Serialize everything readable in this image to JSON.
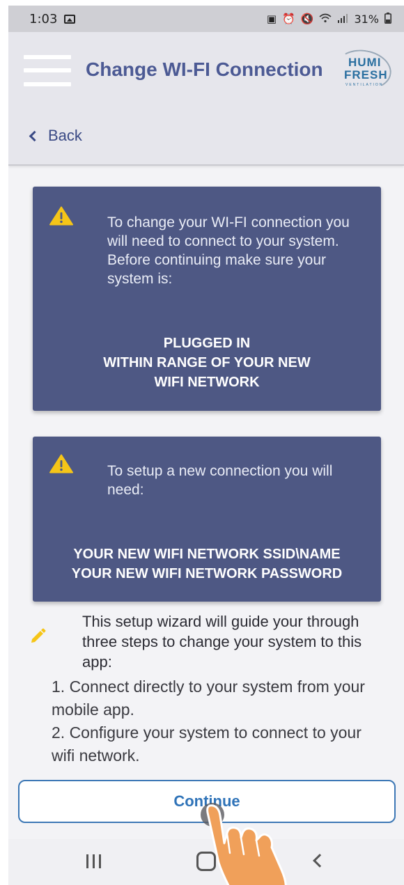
{
  "status_bar": {
    "time": "1:03",
    "battery": "31%",
    "icons": [
      "image-icon",
      "lock-icon",
      "alarm-icon",
      "mute-icon",
      "wifi-icon",
      "signal-icon",
      "battery-icon"
    ]
  },
  "header": {
    "title": "Change WI-FI Connection",
    "menu_icon": "hamburger-menu-icon",
    "logo": {
      "line1": "HUMI",
      "line2": "FRESH",
      "tagline": "VENTILATION"
    }
  },
  "nav": {
    "back_label": "Back",
    "back_icon": "chevron-left-icon"
  },
  "card1": {
    "icon": "warning-icon",
    "message": "To change your WI-FI connection you will need to connect to your system. Before continuing make sure your system is:",
    "requirements": [
      "PLUGGED IN",
      "WITHIN RANGE OF YOUR NEW",
      "WIFI NETWORK"
    ]
  },
  "card2": {
    "icon": "warning-icon",
    "message": "To setup a new connection you will need:",
    "requirements": [
      "YOUR NEW WIFI NETWORK SSID\\NAME",
      "YOUR NEW WIFI NETWORK PASSWORD"
    ]
  },
  "wizard": {
    "icon": "pencil-icon",
    "text": "This setup wizard will guide your through three steps to change your system to this app:",
    "steps": [
      "1. Connect directly to your system from your mobile app.",
      "2. Configure your system to connect to your wifi network."
    ]
  },
  "continue_button": {
    "label": "Continue"
  },
  "system_nav": {
    "icons": [
      "recent-apps-icon",
      "home-icon",
      "back-icon"
    ]
  },
  "colors": {
    "header_title": "#4c5a94",
    "card_bg": "#4e5884",
    "warning": "#f5c518",
    "pencil": "#f5c518",
    "continue_text": "#2f73b8",
    "continue_border": "#3c77b5"
  }
}
